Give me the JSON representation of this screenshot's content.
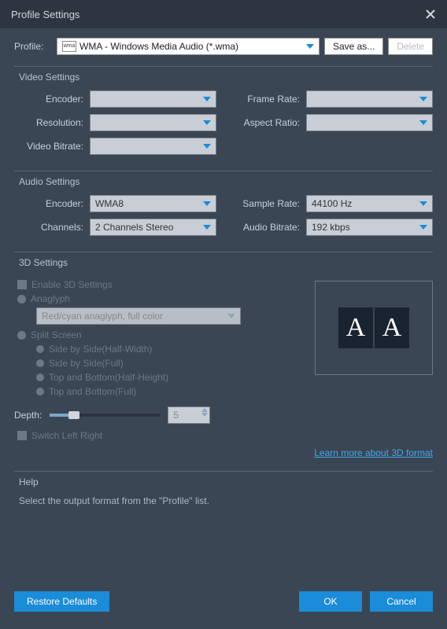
{
  "titlebar": {
    "title": "Profile Settings"
  },
  "profile": {
    "label": "Profile:",
    "value": "WMA - Windows Media Audio (*.wma)",
    "save_as": "Save as...",
    "delete": "Delete"
  },
  "video": {
    "section": "Video Settings",
    "encoder_label": "Encoder:",
    "resolution_label": "Resolution:",
    "bitrate_label": "Video Bitrate:",
    "frame_rate_label": "Frame Rate:",
    "aspect_ratio_label": "Aspect Ratio:",
    "encoder": "",
    "resolution": "",
    "bitrate": "",
    "frame_rate": "",
    "aspect_ratio": ""
  },
  "audio": {
    "section": "Audio Settings",
    "encoder_label": "Encoder:",
    "channels_label": "Channels:",
    "sample_rate_label": "Sample Rate:",
    "bitrate_label": "Audio Bitrate:",
    "encoder": "WMA8",
    "channels": "2 Channels Stereo",
    "sample_rate": "44100 Hz",
    "bitrate": "192 kbps"
  },
  "threeD": {
    "section": "3D Settings",
    "enable": "Enable 3D Settings",
    "anaglyph": "Anaglyph",
    "anaglyph_mode": "Red/cyan anaglyph, full color",
    "split_screen": "Split Screen",
    "sbs_half": "Side by Side(Half-Width)",
    "sbs_full": "Side by Side(Full)",
    "tab_half": "Top and Bottom(Half-Height)",
    "tab_full": "Top and Bottom(Full)",
    "depth_label": "Depth:",
    "depth_value": "5",
    "switch_lr": "Switch Left Right",
    "learn_more": "Learn more about 3D format",
    "preview_a": "A"
  },
  "help": {
    "section": "Help",
    "text": "Select the output format from the \"Profile\" list."
  },
  "buttons": {
    "restore": "Restore Defaults",
    "ok": "OK",
    "cancel": "Cancel"
  }
}
